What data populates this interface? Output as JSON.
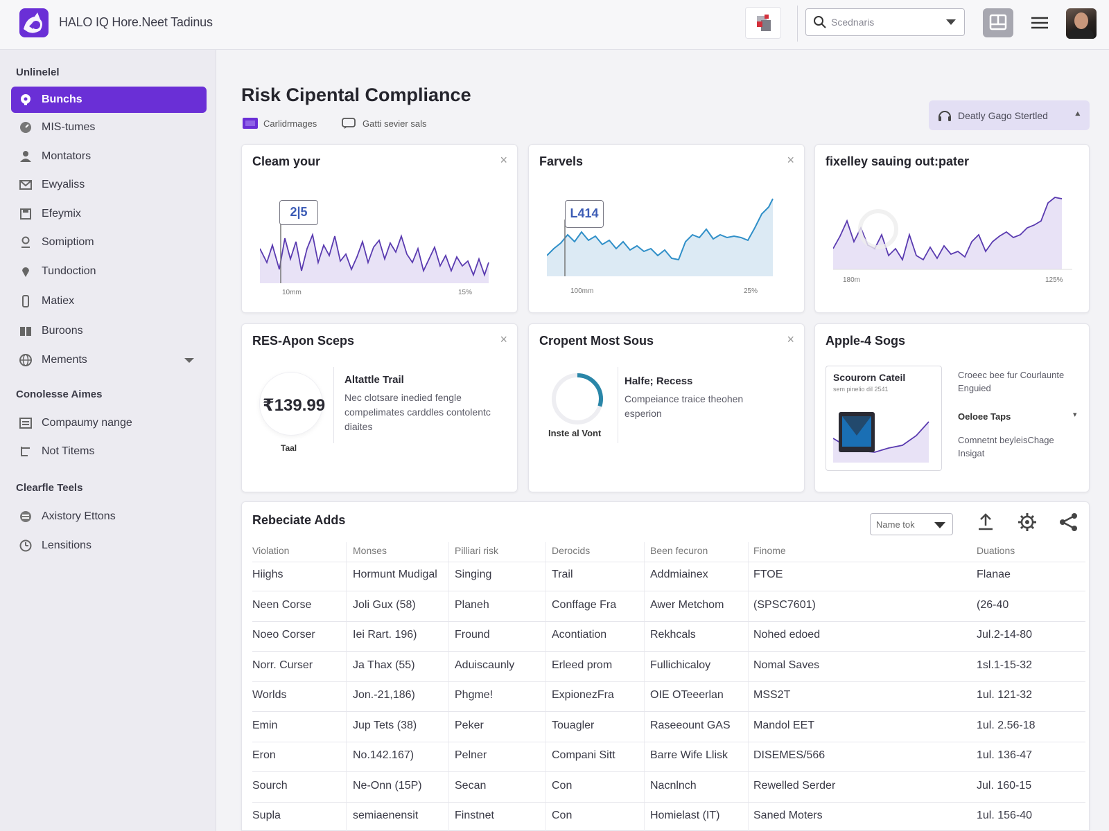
{
  "app": {
    "title": "HALO IQ Hore.Neet Tadinus"
  },
  "search": {
    "placeholder": "Scednaris"
  },
  "sidebar": {
    "section1": "Unlinelel",
    "items1": [
      {
        "label": "Bunchs"
      },
      {
        "label": "MIS-tumes"
      },
      {
        "label": "Montators"
      },
      {
        "label": "Ewyaliss"
      },
      {
        "label": "Efeymix"
      },
      {
        "label": "Somiptiom"
      },
      {
        "label": "Tundoction"
      },
      {
        "label": "Matiex"
      },
      {
        "label": "Buroons"
      },
      {
        "label": "Mements"
      }
    ],
    "section2": "Conolesse Aimes",
    "items2": [
      {
        "label": "Compaumy nange"
      },
      {
        "label": "Not Titems"
      }
    ],
    "section3": "Clearfle Teels",
    "items3": [
      {
        "label": "Axistory Ettons"
      },
      {
        "label": "Lensitions"
      }
    ]
  },
  "main": {
    "title": "Risk Cipental Compliance",
    "subtabs": [
      "Carlidrmages",
      "Gatti sevier sals"
    ],
    "status_pill": "Deatly Gago Stertled"
  },
  "cards": {
    "c1": {
      "title": "Cleam your",
      "tag": "2|5",
      "xmin": "10mm",
      "xmax": "15%"
    },
    "c2": {
      "title": "Farvels",
      "tag": "L414",
      "xmin": "100mm",
      "xmax": "25%"
    },
    "c3": {
      "title": "fixelley sauing out:pater",
      "xmin": "180m",
      "xmax": "125%"
    },
    "c4": {
      "title": "RES-Apon Sceps",
      "kpi_value": "₹139.99",
      "kpi_label": "Taal",
      "head": "Altattle Trail",
      "body": "Nec clotsare inedied fengle compelimates carddles contolentc diaites"
    },
    "c5": {
      "title": "Cropent Most Sous",
      "ring_label": "Inste al Vont",
      "ring_progress": 0.3,
      "head": "Halfe; Recess",
      "body": "Compeiance traice theohen esperion"
    },
    "c6": {
      "title": "Apple-4 Sogs",
      "inner_title": "Scourorn Cateil",
      "inner_sub": "sem pinelio dil 2541",
      "side1": "Croeec bee fur Courlaunte Enguied",
      "side2": "Oeloee Taps",
      "side3": "Comnetnt beyleisChage Insigat"
    }
  },
  "table": {
    "title": "Rebeciate Adds",
    "filter": "Name tok",
    "headers": [
      "Violation",
      "Monses",
      "Pilliari risk",
      "Derocids",
      "Been fecuron",
      "Finome",
      "Duations"
    ],
    "rows": [
      [
        "Hiighs",
        "Hormunt Mudigal",
        "Singing",
        "Trail",
        "Addmiainex",
        "FTOE",
        "Flanae"
      ],
      [
        "Neen Corse",
        "Joli Gux (58)",
        "Planeh",
        "Conffage Fra",
        "Awer Metchom",
        "(SPSC7601)",
        "(26-40"
      ],
      [
        "Noeo Corser",
        "Iei Rart. 196)",
        "Fround",
        "Acontiation",
        "Rekhcals",
        "Nohed edoed",
        "Jul.2-14-80"
      ],
      [
        "Norr. Curser",
        "Ja Thax (55)",
        "Aduiscaunly",
        "Erleed prom",
        "Fullichicaloy",
        "Nomal Saves",
        "1sl.1-15-32"
      ],
      [
        "Worlds",
        "Jon.-21,186)",
        "Phgme!",
        "ExpionezFra",
        "OIE OTeeerlan",
        "MSS2T",
        "1ul. 121-32"
      ],
      [
        "Emin",
        "Jup Tets (38)",
        "Peker",
        "Touagler",
        "Raseeount GAS",
        "Mandol EET",
        "1ul. 2.56-18"
      ],
      [
        "Eron",
        "No.142.167)",
        "Pelner",
        "Compani Sitt",
        "Barre Wife Llisk",
        "DISEMES/566",
        "1ul. 136-47"
      ],
      [
        "Sourch",
        "Ne-Onn (15P)",
        "Secan",
        "Con",
        "Nacnlnch",
        "Rewelled Serder",
        "Jul. 160-15"
      ],
      [
        "Supla",
        "semiaenensit",
        "Finstnet",
        "Con",
        "Homielast (IT)",
        "Saned Moters",
        "1ul. 156-40"
      ]
    ]
  }
}
